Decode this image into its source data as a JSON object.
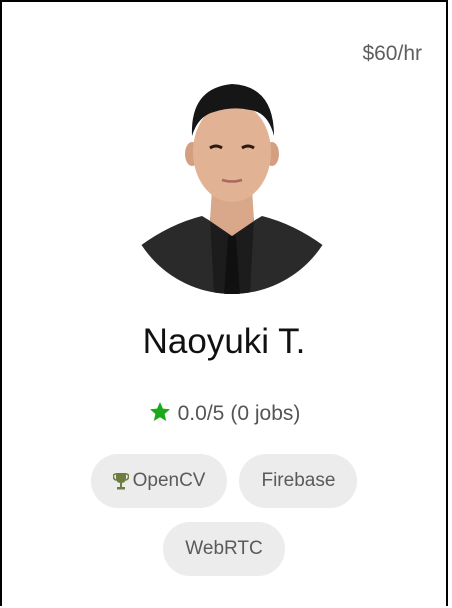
{
  "profile": {
    "rate": "$60/hr",
    "name": "Naoyuki T.",
    "rating": "0.0/5",
    "jobs": "(0 jobs)",
    "skills": [
      {
        "label": "OpenCV",
        "icon": "trophy-icon"
      },
      {
        "label": "Firebase"
      },
      {
        "label": "WebRTC"
      }
    ]
  },
  "colors": {
    "star": "#1aa91a",
    "trophy": "#7a8a4a",
    "chip_bg": "#ececec"
  }
}
